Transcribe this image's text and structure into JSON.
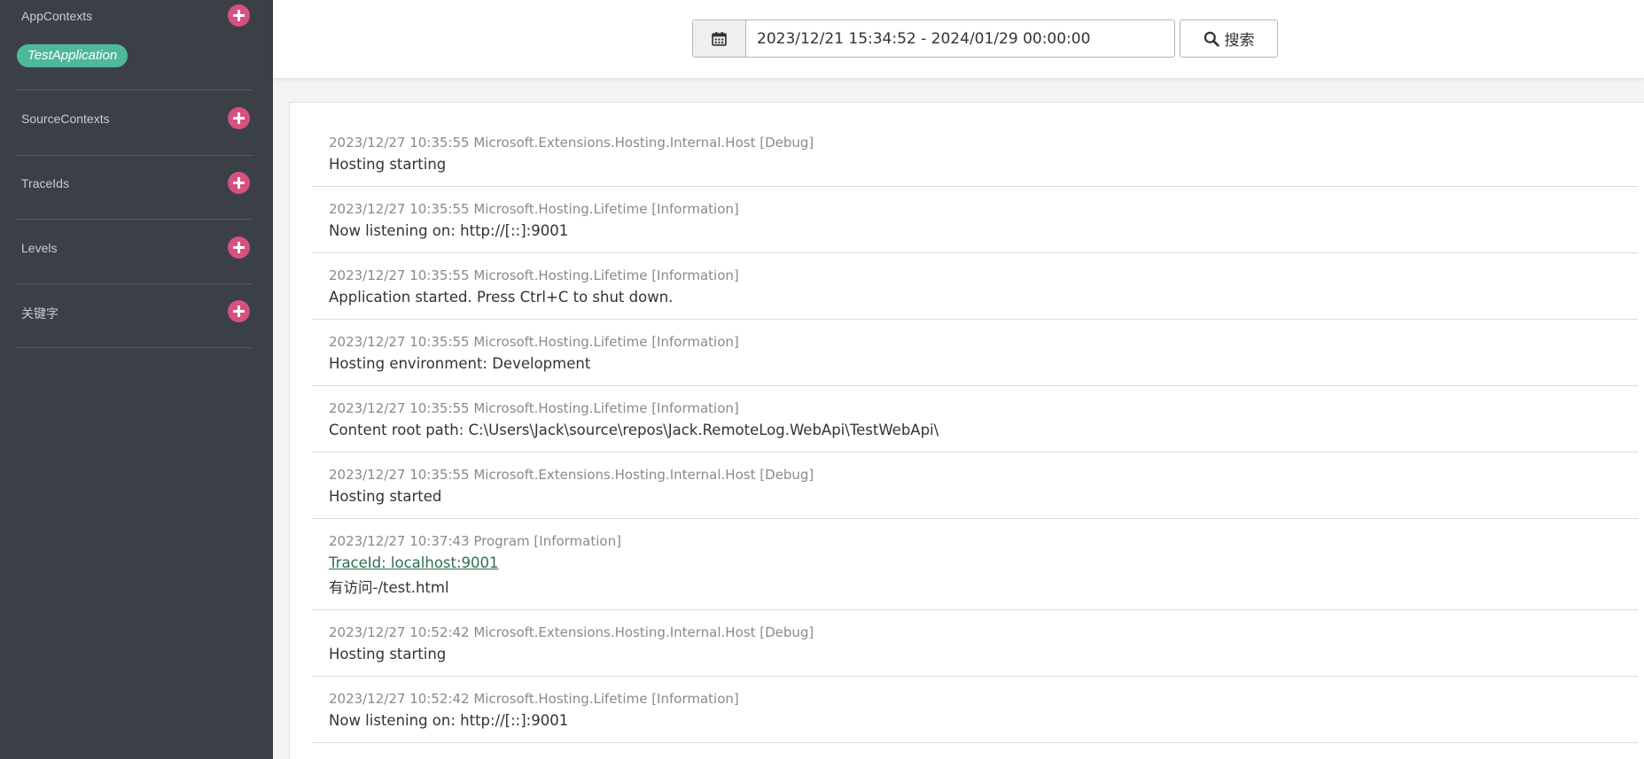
{
  "sidebar": {
    "sections": [
      {
        "label": "AppContexts",
        "tags": [
          "TestApplication"
        ]
      },
      {
        "label": "SourceContexts"
      },
      {
        "label": "TraceIds"
      },
      {
        "label": "Levels"
      },
      {
        "label": "关键字"
      }
    ]
  },
  "toolbar": {
    "date_range": "2023/12/21 15:34:52 - 2024/01/29 00:00:00",
    "search_label": "搜索",
    "calendar_icon": "calendar-icon",
    "search_icon": "search-icon"
  },
  "logs": [
    {
      "meta": "2023/12/27 10:35:55 Microsoft.Extensions.Hosting.Internal.Host [Debug]",
      "message": "Hosting starting"
    },
    {
      "meta": "2023/12/27 10:35:55 Microsoft.Hosting.Lifetime [Information]",
      "message": "Now listening on: http://[::]:9001"
    },
    {
      "meta": "2023/12/27 10:35:55 Microsoft.Hosting.Lifetime [Information]",
      "message": "Application started. Press Ctrl+C to shut down."
    },
    {
      "meta": "2023/12/27 10:35:55 Microsoft.Hosting.Lifetime [Information]",
      "message": "Hosting environment: Development"
    },
    {
      "meta": "2023/12/27 10:35:55 Microsoft.Hosting.Lifetime [Information]",
      "message": "Content root path: C:\\Users\\Jack\\source\\repos\\Jack.RemoteLog.WebApi\\TestWebApi\\"
    },
    {
      "meta": "2023/12/27 10:35:55 Microsoft.Extensions.Hosting.Internal.Host [Debug]",
      "message": "Hosting started"
    },
    {
      "meta": "2023/12/27 10:37:43 Program [Information]",
      "trace": "TraceId: localhost:9001",
      "message": "有访问-/test.html"
    },
    {
      "meta": "2023/12/27 10:52:42 Microsoft.Extensions.Hosting.Internal.Host [Debug]",
      "message": "Hosting starting"
    },
    {
      "meta": "2023/12/27 10:52:42 Microsoft.Hosting.Lifetime [Information]",
      "message": "Now listening on: http://[::]:9001"
    }
  ],
  "colors": {
    "sidebar_bg": "#3b4047",
    "plus_button": "#d7517f",
    "tag": "#4fb89a",
    "trace_link": "#2e6e4e"
  }
}
